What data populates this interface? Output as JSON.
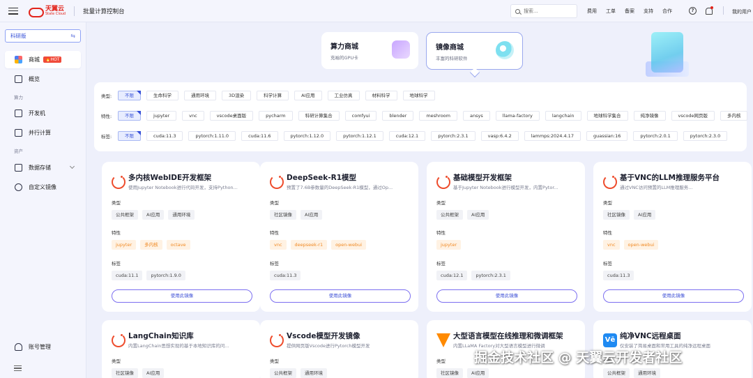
{
  "header": {
    "logo_cn": "天翼云",
    "logo_en": "State Cloud",
    "console_title": "批量计算控制台",
    "search_placeholder": "搜索...",
    "links": [
      "费用",
      "工单",
      "备案",
      "支持",
      "合作"
    ],
    "help": "?",
    "user": "我的用户"
  },
  "sidebar": {
    "edition": "科研版",
    "items": [
      {
        "label": "商城",
        "badge": "HOT"
      },
      {
        "label": "概览"
      }
    ],
    "section_compute": "算力",
    "compute_items": [
      "开发机",
      "并行计算"
    ],
    "section_assets": "资产",
    "asset_items": [
      "数据存储",
      "自定义镜像"
    ],
    "account": "账号管理"
  },
  "banners": [
    {
      "title": "算力商城",
      "subtitle": "充裕的GPU卡"
    },
    {
      "title": "镜像商城",
      "subtitle": "丰富的科研软件"
    }
  ],
  "filters": [
    {
      "label": "类型:",
      "options": [
        "不限",
        "生命科学",
        "通用环境",
        "3D渲染",
        "科学计算",
        "AI应用",
        "工业仿真",
        "材料科学",
        "地球科学"
      ]
    },
    {
      "label": "特性:",
      "options": [
        "不限",
        "jupyter",
        "vnc",
        "vscode桌面版",
        "pycharm",
        "科研计算集合",
        "comfyui",
        "blender",
        "meshroom",
        "ansys",
        "llama-factory",
        "langchain",
        "地球科学集合",
        "纯净镜像",
        "vscode网页版",
        "多内核"
      ]
    },
    {
      "label": "标签:",
      "options": [
        "不限",
        "cuda:11.3",
        "pytorch:1.11.0",
        "cuda:11.6",
        "pytorch:1.12.0",
        "pytorch:1.12.1",
        "cuda:12.1",
        "pytorch:2.3.1",
        "vasp:6.4.2",
        "lammps:2024.4.17",
        "guassian:16",
        "pytorch:2.0.1",
        "pytorch:2.3.0"
      ]
    }
  ],
  "section_labels": {
    "type": "类型",
    "feature": "特性",
    "tag": "标签"
  },
  "use_button": "使用此镜像",
  "cards": [
    {
      "title": "多内核WebIDE开发框架",
      "desc": "使用Jupyter Notebook进行代码开发，支持Python...",
      "logo": "pytorch-icon",
      "types": [
        "公共框架",
        "AI应用",
        "通用环境"
      ],
      "features": [
        "jupyter",
        "多内核",
        "octave"
      ],
      "tags": [
        "cuda:11.1",
        "pytorch:1.9.0"
      ]
    },
    {
      "title": "DeepSeek-R1模型",
      "desc": "预置了7.6B参数量的DeepSeek-R1模型，通过Op...",
      "logo": "pytorch-icon",
      "types": [
        "社区镜像",
        "AI应用"
      ],
      "features": [
        "vnc",
        "deepseek-r1",
        "open-webui"
      ],
      "tags": [
        "cuda:11.3"
      ]
    },
    {
      "title": "基础模型开发框架",
      "desc": "基于Jupyter Notebook进行模型开发，内置Pytor...",
      "logo": "pytorch-icon",
      "types": [
        "公共框架",
        "AI应用"
      ],
      "features": [
        "jupyter"
      ],
      "tags": [
        "cuda:12.1",
        "pytorch:2.3.1"
      ]
    },
    {
      "title": "基于VNC的LLM推理服务平台",
      "desc": "通过VNC访问预置的LLM推理服务...",
      "logo": "pytorch-icon",
      "types": [
        "社区镜像",
        "AI应用"
      ],
      "features": [
        "vnc",
        "open-webui"
      ],
      "tags": [
        "cuda:11.3"
      ]
    },
    {
      "title": "LangChain知识库",
      "desc": "内置LangChain思想实现的基于本地知识库的问...",
      "logo": "pytorch-icon",
      "types": [
        "社区镜像",
        "AI应用"
      ]
    },
    {
      "title": "Vscode模型开发镜像",
      "desc": "提供网页版Vscode进行Pytorch模型开发",
      "logo": "pytorch-icon",
      "types": [
        "公共框架",
        "通用环境"
      ]
    },
    {
      "title": "大型语言模型在线推理和微调框架",
      "desc": "内置LLaMA Factory对大型语言模型进行微调",
      "logo": "tensorflow-icon",
      "types": [
        "社区镜像",
        "AI应用"
      ]
    },
    {
      "title": "纯净VNC远程桌面",
      "desc": "仅安装了简易桌面和常用工具的纯净远程桌面",
      "logo": "vnc-icon",
      "logo_text": "Vē",
      "types": [
        "公共框架",
        "通用环境"
      ]
    }
  ],
  "watermark": "掘金技术社区 @ 天翼云开发者社区"
}
